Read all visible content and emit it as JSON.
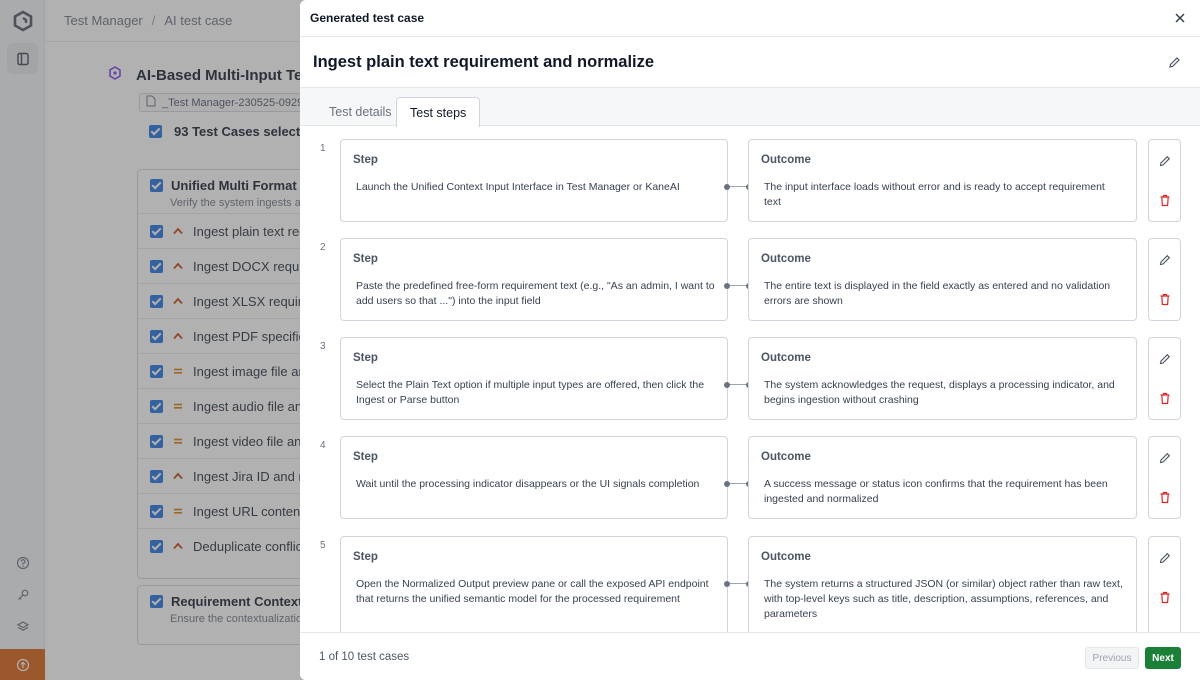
{
  "breadcrumb": {
    "root": "Test Manager",
    "separator": "/",
    "current": "AI test case"
  },
  "suite": {
    "title": "AI-Based Multi-Input Test C",
    "file_chip": "_Test Manager-230525-09290",
    "selected_label": "93 Test Cases selected a"
  },
  "groups": [
    {
      "title": "Unified Multi Format Inpu",
      "description": "Verify the system ingests and",
      "rows": [
        {
          "priority": "high",
          "label": "Ingest plain text requ"
        },
        {
          "priority": "high",
          "label": "Ingest DOCX requirem"
        },
        {
          "priority": "high",
          "label": "Ingest XLSX requirem"
        },
        {
          "priority": "high",
          "label": "Ingest PDF specificat"
        },
        {
          "priority": "med",
          "label": "Ingest image file and"
        },
        {
          "priority": "med",
          "label": "Ingest audio file and"
        },
        {
          "priority": "med",
          "label": "Ingest video file and"
        },
        {
          "priority": "high",
          "label": "Ingest Jira ID and nor"
        },
        {
          "priority": "med",
          "label": "Ingest URL content a"
        },
        {
          "priority": "high",
          "label": "Deduplicate conflictin"
        }
      ]
    },
    {
      "title": "Requirement Contextualiz",
      "description": "Ensure the contextualization",
      "rows": []
    }
  ],
  "drawer": {
    "title": "Generated test case",
    "test_case_title": "Ingest plain text requirement and normalize",
    "tabs": [
      {
        "label": "Test details",
        "active": false
      },
      {
        "label": "Test steps",
        "active": true
      }
    ],
    "step_label": "Step",
    "outcome_label": "Outcome",
    "steps": [
      {
        "number": "1",
        "step": "Launch the Unified Context Input Interface in Test Manager or KaneAI",
        "outcome": "The input interface loads without error and is ready to accept requirement text"
      },
      {
        "number": "2",
        "step": "Paste the predefined free-form requirement text (e.g., \"As an admin, I want to add users so that ...\") into the input field",
        "outcome": "The entire text is displayed in the field exactly as entered and no validation errors are shown"
      },
      {
        "number": "3",
        "step": "Select the Plain Text option if multiple input types are offered, then click the Ingest or Parse button",
        "outcome": "The system acknowledges the request, displays a processing indicator, and begins ingestion without crashing"
      },
      {
        "number": "4",
        "step": "Wait until the processing indicator disappears or the UI signals completion",
        "outcome": "A success message or status icon confirms that the requirement has been ingested and normalized"
      },
      {
        "number": "5",
        "step": "Open the Normalized Output preview pane or call the exposed API endpoint that returns the unified semantic model for the processed requirement",
        "outcome": "The system returns a structured JSON (or similar) object rather than raw text, with top-level keys such as title, description, assumptions, references, and parameters"
      }
    ],
    "footer": {
      "count": "1 of 10 test cases",
      "previous": "Previous",
      "next": "Next"
    }
  },
  "colors": {
    "accent_blue": "#1d6fe0",
    "next_green": "#1a7f37",
    "delete_red": "#dc2626",
    "upgrade_orange": "#d95d10",
    "priority_high": "#c2410c",
    "priority_medium": "#d97706"
  },
  "icons": {
    "logo": "app-logo-icon",
    "sidebar": [
      "test-manager-icon",
      "help-icon",
      "key-icon",
      "layers-icon",
      "upgrade-arrow-icon"
    ],
    "close": "close-icon",
    "edit": "pencil-icon",
    "delete": "trash-icon"
  }
}
